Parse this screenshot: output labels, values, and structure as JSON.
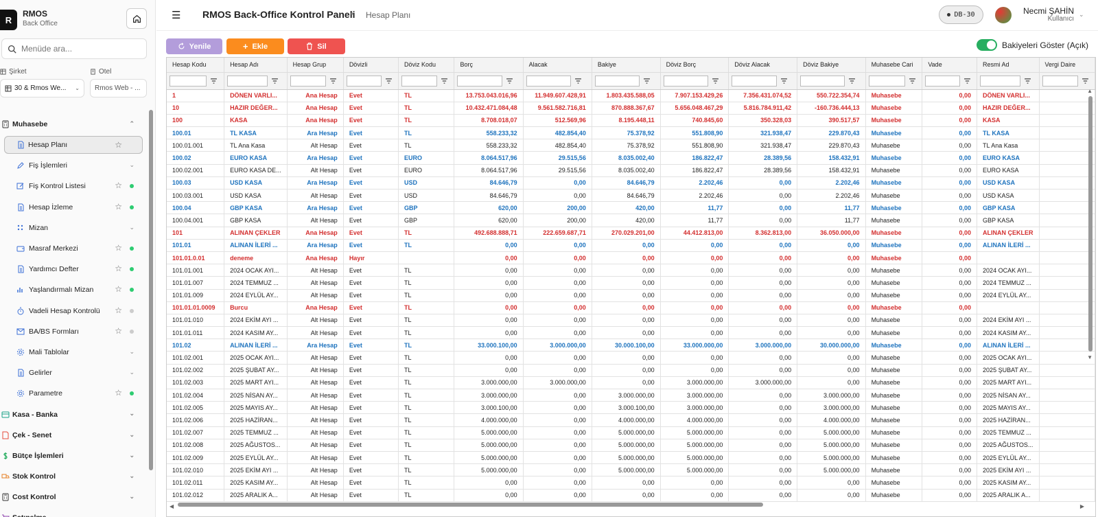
{
  "brand": {
    "initial": "R",
    "name": "RMOS",
    "sub": "Back Office"
  },
  "search": {
    "placeholder": "Menüde ara..."
  },
  "selectors": {
    "company_label": "Şirket",
    "company_value": "30 & Rmos We...",
    "hotel_label": "Otel",
    "hotel_value": "Rmos Web - ..."
  },
  "menu": [
    {
      "label": "Muhasebe",
      "level": "top",
      "icon": "calculator-icon",
      "expanded": true
    },
    {
      "label": "Hesap Planı",
      "level": "sub",
      "icon": "document-icon",
      "active": true,
      "star": true
    },
    {
      "label": "Fiş İşlemleri",
      "level": "sub",
      "icon": "pen-icon",
      "chevron": true
    },
    {
      "label": "Fiş Kontrol Listesi",
      "level": "sub",
      "icon": "edit-icon",
      "star": true,
      "dot": "#2ecc71"
    },
    {
      "label": "Hesap İzleme",
      "level": "sub",
      "icon": "document-icon",
      "star": true,
      "dot": "#2ecc71"
    },
    {
      "label": "Mizan",
      "level": "sub",
      "icon": "grid-icon",
      "chevron": true
    },
    {
      "label": "Masraf Merkezi",
      "level": "sub",
      "icon": "wallet-icon",
      "star": true,
      "dot": "#2ecc71"
    },
    {
      "label": "Yardımcı Defter",
      "level": "sub",
      "icon": "document-icon",
      "star": true,
      "dot": "#2ecc71"
    },
    {
      "label": "Yaşlandırmalı Mizan",
      "level": "sub",
      "icon": "bar-chart-icon",
      "star": true,
      "dot": "#2ecc71"
    },
    {
      "label": "Vadeli Hesap Kontrolü",
      "level": "sub",
      "icon": "timer-icon",
      "star": true,
      "dot": "#cccccc"
    },
    {
      "label": "BA/BS Formları",
      "level": "sub",
      "icon": "mail-icon",
      "star": true,
      "dot": "#cccccc"
    },
    {
      "label": "Mali Tablolar",
      "level": "sub",
      "icon": "gear-icon",
      "chevron": true
    },
    {
      "label": "Gelirler",
      "level": "sub",
      "icon": "document-icon",
      "chevron": true
    },
    {
      "label": "Parametre",
      "level": "sub",
      "icon": "gear-icon",
      "star": true,
      "dot": "#2ecc71"
    },
    {
      "label": "Kasa - Banka",
      "level": "top",
      "icon": "card-icon",
      "chevron": true
    },
    {
      "label": "Çek - Senet",
      "level": "top",
      "icon": "check-doc-icon",
      "chevron": true
    },
    {
      "label": "Bütçe İşlemleri",
      "level": "top",
      "icon": "dollar-icon",
      "chevron": true
    },
    {
      "label": "Stok Kontrol",
      "level": "top",
      "icon": "truck-icon",
      "chevron": true
    },
    {
      "label": "Cost Kontrol",
      "level": "top",
      "icon": "calculator-icon",
      "chevron": true
    },
    {
      "label": "Satınalma",
      "level": "top",
      "icon": "cart-icon",
      "chevron": true
    }
  ],
  "header": {
    "title": "RMOS Back-Office Kontrol Paneli",
    "separator": "•",
    "subtitle": "Hesap Planı",
    "db": "DB-30",
    "user_name": "Necmi ŞAHİN",
    "user_role": "Kullanıcı"
  },
  "toolbar": {
    "refresh": "Yenile",
    "add": "Ekle",
    "delete": "Sil",
    "toggle_label": "Bakiyeleri Göster (Açık)"
  },
  "colors": {
    "refresh": "#b39ddb",
    "add": "#fb8c1e",
    "delete": "#ef5350",
    "red": "#d32f2f",
    "blue": "#1e73be",
    "toggle": "#27ae60"
  },
  "table": {
    "columns": [
      "Hesap Kodu",
      "Hesap Adı",
      "Hesap Grup",
      "Dövizli",
      "Döviz Kodu",
      "Borç",
      "Alacak",
      "Bakiye",
      "Döviz Borç",
      "Döviz Alacak",
      "Döviz Bakiye",
      "Muhasebe Cari",
      "Vade",
      "Resmi Ad",
      "Vergi Daire"
    ],
    "rows": [
      {
        "t": "red",
        "c": [
          "1",
          "DÖNEN VARLI...",
          "Ana Hesap",
          "Evet",
          "TL",
          "13.753.043.016,96",
          "11.949.607.428,91",
          "1.803.435.588,05",
          "7.907.153.429,26",
          "7.356.431.074,52",
          "550.722.354,74",
          "Muhasebe",
          "0,00",
          "DÖNEN VARLI...",
          ""
        ]
      },
      {
        "t": "red",
        "c": [
          "10",
          "HAZIR DEĞER...",
          "Ana Hesap",
          "Evet",
          "TL",
          "10.432.471.084,48",
          "9.561.582.716,81",
          "870.888.367,67",
          "5.656.048.467,29",
          "5.816.784.911,42",
          "-160.736.444,13",
          "Muhasebe",
          "0,00",
          "HAZIR DEĞER...",
          ""
        ]
      },
      {
        "t": "red",
        "c": [
          "100",
          "KASA",
          "Ana Hesap",
          "Evet",
          "TL",
          "8.708.018,07",
          "512.569,96",
          "8.195.448,11",
          "740.845,60",
          "350.328,03",
          "390.517,57",
          "Muhasebe",
          "0,00",
          "KASA",
          ""
        ]
      },
      {
        "t": "blue",
        "c": [
          "100.01",
          "TL KASA",
          "Ara Hesap",
          "Evet",
          "TL",
          "558.233,32",
          "482.854,40",
          "75.378,92",
          "551.808,90",
          "321.938,47",
          "229.870,43",
          "Muhasebe",
          "0,00",
          "TL KASA",
          ""
        ]
      },
      {
        "t": "norm",
        "c": [
          "100.01.001",
          "TL Ana Kasa",
          "Alt Hesap",
          "Evet",
          "TL",
          "558.233,32",
          "482.854,40",
          "75.378,92",
          "551.808,90",
          "321.938,47",
          "229.870,43",
          "Muhasebe",
          "0,00",
          "TL Ana Kasa",
          ""
        ]
      },
      {
        "t": "blue",
        "c": [
          "100.02",
          "EURO KASA",
          "Ara Hesap",
          "Evet",
          "EURO",
          "8.064.517,96",
          "29.515,56",
          "8.035.002,40",
          "186.822,47",
          "28.389,56",
          "158.432,91",
          "Muhasebe",
          "0,00",
          "EURO KASA",
          ""
        ]
      },
      {
        "t": "norm",
        "c": [
          "100.02.001",
          "EURO KASA DE...",
          "Alt Hesap",
          "Evet",
          "EURO",
          "8.064.517,96",
          "29.515,56",
          "8.035.002,40",
          "186.822,47",
          "28.389,56",
          "158.432,91",
          "Muhasebe",
          "0,00",
          "EURO KASA",
          ""
        ]
      },
      {
        "t": "blue",
        "c": [
          "100.03",
          "USD KASA",
          "Ara Hesap",
          "Evet",
          "USD",
          "84.646,79",
          "0,00",
          "84.646,79",
          "2.202,46",
          "0,00",
          "2.202,46",
          "Muhasebe",
          "0,00",
          "USD KASA",
          ""
        ]
      },
      {
        "t": "norm",
        "c": [
          "100.03.001",
          "USD KASA",
          "Alt Hesap",
          "Evet",
          "USD",
          "84.646,79",
          "0,00",
          "84.646,79",
          "2.202,46",
          "0,00",
          "2.202,46",
          "Muhasebe",
          "0,00",
          "USD KASA",
          ""
        ]
      },
      {
        "t": "blue",
        "c": [
          "100.04",
          "GBP KASA",
          "Ara Hesap",
          "Evet",
          "GBP",
          "620,00",
          "200,00",
          "420,00",
          "11,77",
          "0,00",
          "11,77",
          "Muhasebe",
          "0,00",
          "GBP KASA",
          ""
        ]
      },
      {
        "t": "norm",
        "c": [
          "100.04.001",
          "GBP KASA",
          "Alt Hesap",
          "Evet",
          "GBP",
          "620,00",
          "200,00",
          "420,00",
          "11,77",
          "0,00",
          "11,77",
          "Muhasebe",
          "0,00",
          "GBP KASA",
          ""
        ]
      },
      {
        "t": "red",
        "c": [
          "101",
          "ALINAN ÇEKLER",
          "Ana Hesap",
          "Evet",
          "TL",
          "492.688.888,71",
          "222.659.687,71",
          "270.029.201,00",
          "44.412.813,00",
          "8.362.813,00",
          "36.050.000,00",
          "Muhasebe",
          "0,00",
          "ALINAN ÇEKLER",
          ""
        ]
      },
      {
        "t": "blue",
        "c": [
          "101.01",
          "ALINAN İLERİ ...",
          "Ara Hesap",
          "Evet",
          "TL",
          "0,00",
          "0,00",
          "0,00",
          "0,00",
          "0,00",
          "0,00",
          "Muhasebe",
          "0,00",
          "ALINAN İLERİ ...",
          ""
        ]
      },
      {
        "t": "red",
        "c": [
          "101.01.0.01",
          "deneme",
          "Ana Hesap",
          "Hayır",
          "",
          "0,00",
          "0,00",
          "0,00",
          "0,00",
          "0,00",
          "0,00",
          "Muhasebe",
          "0,00",
          "",
          ""
        ]
      },
      {
        "t": "norm",
        "c": [
          "101.01.001",
          "2024 OCAK AYI...",
          "Alt Hesap",
          "Evet",
          "TL",
          "0,00",
          "0,00",
          "0,00",
          "0,00",
          "0,00",
          "0,00",
          "Muhasebe",
          "0,00",
          "2024 OCAK AYI...",
          ""
        ]
      },
      {
        "t": "norm",
        "c": [
          "101.01.007",
          "2024 TEMMUZ ...",
          "Alt Hesap",
          "Evet",
          "TL",
          "0,00",
          "0,00",
          "0,00",
          "0,00",
          "0,00",
          "0,00",
          "Muhasebe",
          "0,00",
          "2024 TEMMUZ ...",
          ""
        ]
      },
      {
        "t": "norm",
        "c": [
          "101.01.009",
          "2024 EYLÜL AY...",
          "Alt Hesap",
          "Evet",
          "TL",
          "0,00",
          "0,00",
          "0,00",
          "0,00",
          "0,00",
          "0,00",
          "Muhasebe",
          "0,00",
          "2024 EYLÜL AY...",
          ""
        ]
      },
      {
        "t": "red",
        "c": [
          "101.01.01.0009",
          "Burcu",
          "Ana Hesap",
          "Evet",
          "TL",
          "0,00",
          "0,00",
          "0,00",
          "0,00",
          "0,00",
          "0,00",
          "Muhasebe",
          "0,00",
          "",
          ""
        ]
      },
      {
        "t": "norm",
        "c": [
          "101.01.010",
          "2024 EKİM AYI ...",
          "Alt Hesap",
          "Evet",
          "TL",
          "0,00",
          "0,00",
          "0,00",
          "0,00",
          "0,00",
          "0,00",
          "Muhasebe",
          "0,00",
          "2024 EKİM AYI ...",
          ""
        ]
      },
      {
        "t": "norm",
        "c": [
          "101.01.011",
          "2024 KASIM AY...",
          "Alt Hesap",
          "Evet",
          "TL",
          "0,00",
          "0,00",
          "0,00",
          "0,00",
          "0,00",
          "0,00",
          "Muhasebe",
          "0,00",
          "2024 KASIM AY...",
          ""
        ]
      },
      {
        "t": "blue",
        "c": [
          "101.02",
          "ALINAN İLERİ ...",
          "Ara Hesap",
          "Evet",
          "TL",
          "33.000.100,00",
          "3.000.000,00",
          "30.000.100,00",
          "33.000.000,00",
          "3.000.000,00",
          "30.000.000,00",
          "Muhasebe",
          "0,00",
          "ALINAN İLERİ ...",
          ""
        ]
      },
      {
        "t": "norm",
        "c": [
          "101.02.001",
          "2025 OCAK AYI...",
          "Alt Hesap",
          "Evet",
          "TL",
          "0,00",
          "0,00",
          "0,00",
          "0,00",
          "0,00",
          "0,00",
          "Muhasebe",
          "0,00",
          "2025 OCAK AYI...",
          ""
        ]
      },
      {
        "t": "norm",
        "c": [
          "101.02.002",
          "2025 ŞUBAT AY...",
          "Alt Hesap",
          "Evet",
          "TL",
          "0,00",
          "0,00",
          "0,00",
          "0,00",
          "0,00",
          "0,00",
          "Muhasebe",
          "0,00",
          "2025 ŞUBAT AY...",
          ""
        ]
      },
      {
        "t": "norm",
        "c": [
          "101.02.003",
          "2025 MART AYI...",
          "Alt Hesap",
          "Evet",
          "TL",
          "3.000.000,00",
          "3.000.000,00",
          "0,00",
          "3.000.000,00",
          "3.000.000,00",
          "0,00",
          "Muhasebe",
          "0,00",
          "2025 MART AYI...",
          ""
        ]
      },
      {
        "t": "norm",
        "c": [
          "101.02.004",
          "2025 NİSAN AY...",
          "Alt Hesap",
          "Evet",
          "TL",
          "3.000.000,00",
          "0,00",
          "3.000.000,00",
          "3.000.000,00",
          "0,00",
          "3.000.000,00",
          "Muhasebe",
          "0,00",
          "2025 NİSAN AY...",
          ""
        ]
      },
      {
        "t": "norm",
        "c": [
          "101.02.005",
          "2025 MAYIS AY...",
          "Alt Hesap",
          "Evet",
          "TL",
          "3.000.100,00",
          "0,00",
          "3.000.100,00",
          "3.000.000,00",
          "0,00",
          "3.000.000,00",
          "Muhasebe",
          "0,00",
          "2025 MAYIS AY...",
          ""
        ]
      },
      {
        "t": "norm",
        "c": [
          "101.02.006",
          "2025 HAZİRAN...",
          "Alt Hesap",
          "Evet",
          "TL",
          "4.000.000,00",
          "0,00",
          "4.000.000,00",
          "4.000.000,00",
          "0,00",
          "4.000.000,00",
          "Muhasebe",
          "0,00",
          "2025 HAZİRAN...",
          ""
        ]
      },
      {
        "t": "norm",
        "c": [
          "101.02.007",
          "2025 TEMMUZ ...",
          "Alt Hesap",
          "Evet",
          "TL",
          "5.000.000,00",
          "0,00",
          "5.000.000,00",
          "5.000.000,00",
          "0,00",
          "5.000.000,00",
          "Muhasebe",
          "0,00",
          "2025 TEMMUZ ...",
          ""
        ]
      },
      {
        "t": "norm",
        "c": [
          "101.02.008",
          "2025 AĞUSTOS...",
          "Alt Hesap",
          "Evet",
          "TL",
          "5.000.000,00",
          "0,00",
          "5.000.000,00",
          "5.000.000,00",
          "0,00",
          "5.000.000,00",
          "Muhasebe",
          "0,00",
          "2025 AĞUSTOS...",
          ""
        ]
      },
      {
        "t": "norm",
        "c": [
          "101.02.009",
          "2025 EYLÜL AY...",
          "Alt Hesap",
          "Evet",
          "TL",
          "5.000.000,00",
          "0,00",
          "5.000.000,00",
          "5.000.000,00",
          "0,00",
          "5.000.000,00",
          "Muhasebe",
          "0,00",
          "2025 EYLÜL AY...",
          ""
        ]
      },
      {
        "t": "norm",
        "c": [
          "101.02.010",
          "2025 EKİM AYI ...",
          "Alt Hesap",
          "Evet",
          "TL",
          "5.000.000,00",
          "0,00",
          "5.000.000,00",
          "5.000.000,00",
          "0,00",
          "5.000.000,00",
          "Muhasebe",
          "0,00",
          "2025 EKİM AYI ...",
          ""
        ]
      },
      {
        "t": "norm",
        "c": [
          "101.02.011",
          "2025 KASIM AY...",
          "Alt Hesap",
          "Evet",
          "TL",
          "0,00",
          "0,00",
          "0,00",
          "0,00",
          "0,00",
          "0,00",
          "Muhasebe",
          "0,00",
          "2025 KASIM AY...",
          ""
        ]
      },
      {
        "t": "norm",
        "c": [
          "101.02.012",
          "2025 ARALIK A...",
          "Alt Hesap",
          "Evet",
          "TL",
          "0,00",
          "0,00",
          "0,00",
          "0,00",
          "0,00",
          "0,00",
          "Muhasebe",
          "0,00",
          "2025 ARALIK A...",
          ""
        ]
      }
    ]
  }
}
